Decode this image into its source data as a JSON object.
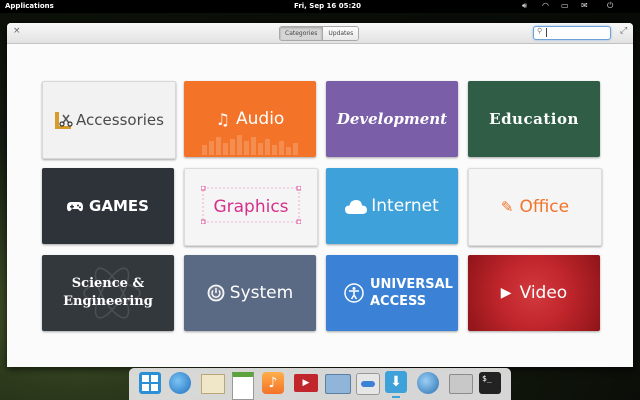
{
  "panel": {
    "apps": "Applications",
    "clock": "Fri, Sep 16    05:20"
  },
  "header": {
    "categories_tab": "Categories",
    "updates_tab": "Updates",
    "search_placeholder": ""
  },
  "categories": [
    {
      "label": "Accessories",
      "icon": "accessories-icon",
      "bg": "#f2f2f2",
      "fg": "#444444"
    },
    {
      "label": "Audio",
      "icon": "music-note-icon",
      "bg": "#f37329",
      "fg": "#ffffff"
    },
    {
      "label": "Development",
      "icon": "",
      "bg": "#7b5ea8",
      "fg": "#ffffff"
    },
    {
      "label": "Education",
      "icon": "",
      "bg": "#2f5d46",
      "fg": "#ffffff"
    },
    {
      "label": "GAMES",
      "icon": "gamepad-icon",
      "bg": "#2d3339",
      "fg": "#ffffff"
    },
    {
      "label": "Graphics",
      "icon": "",
      "bg": "#f5f5f5",
      "fg": "#d6308a"
    },
    {
      "label": "Internet",
      "icon": "cloud-icon",
      "bg": "#3ea1d9",
      "fg": "#ffffff"
    },
    {
      "label": "Office",
      "icon": "pencil-icon",
      "bg": "#f5f5f5",
      "fg": "#f37329"
    },
    {
      "label": "Science & Engineering",
      "icon": "",
      "bg": "#33383d",
      "fg": "#ffffff"
    },
    {
      "label": "System",
      "icon": "power-icon",
      "bg": "#5b6a84",
      "fg": "#ffffff"
    },
    {
      "label": "UNIVERSAL ACCESS",
      "icon": "accessibility-icon",
      "bg": "#3b82d6",
      "fg": "#ffffff"
    },
    {
      "label": "Video",
      "icon": "play-icon",
      "bg": "#c0262c",
      "fg": "#ffffff"
    }
  ],
  "dock": [
    "multitasking-icon",
    "browser-icon",
    "mail-icon",
    "calendar-icon",
    "music-icon",
    "videos-icon",
    "photos-icon",
    "switchboard-icon",
    "appcenter-icon",
    "updater-icon",
    "files-icon",
    "terminal-icon"
  ]
}
